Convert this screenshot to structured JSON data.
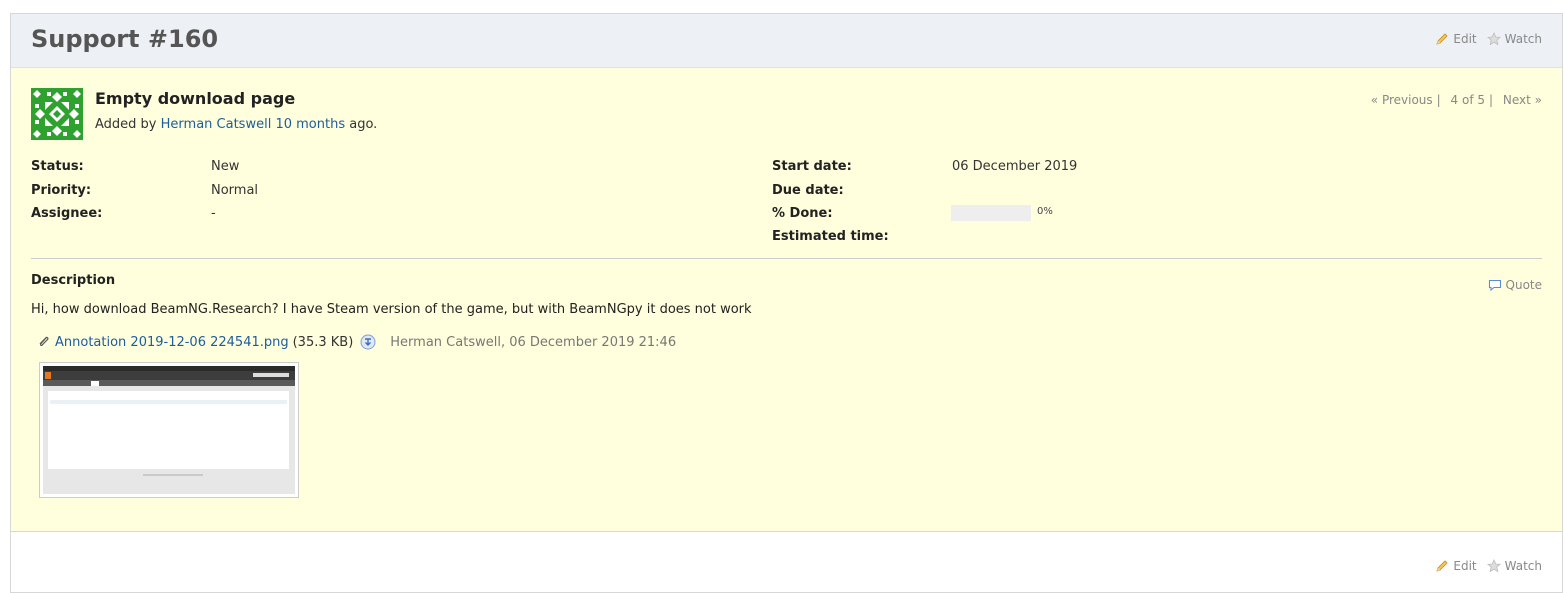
{
  "header": {
    "title": "Support #160",
    "edit_label": "Edit",
    "watch_label": "Watch"
  },
  "issue": {
    "subject": "Empty download page",
    "added_by_prefix": "Added by",
    "author": "Herman Catswell",
    "age": "10 months",
    "age_suffix": "ago.",
    "nav": {
      "previous": "« Previous",
      "position": "4 of 5",
      "next": "Next »"
    },
    "attributes": {
      "status": {
        "label": "Status:",
        "value": "New"
      },
      "priority": {
        "label": "Priority:",
        "value": "Normal"
      },
      "assignee": {
        "label": "Assignee:",
        "value": "-"
      },
      "start_date": {
        "label": "Start date:",
        "value": "06 December 2019"
      },
      "due_date": {
        "label": "Due date:",
        "value": ""
      },
      "done": {
        "label": "% Done:",
        "value": "0%",
        "fraction": 0
      },
      "estimated": {
        "label": "Estimated time:",
        "value": ""
      }
    },
    "description": {
      "title": "Description",
      "quote_label": "Quote",
      "text": "Hi, how download BeamNG.Research? I have Steam version of the game, but with BeamNGpy it does not work"
    },
    "attachment": {
      "filename": "Annotation 2019-12-06 224541.png",
      "size": "(35.3 KB)",
      "meta": "Herman Catswell, 06 December 2019 21:46"
    }
  },
  "footer": {
    "edit_label": "Edit",
    "watch_label": "Watch"
  },
  "colors": {
    "header_bg": "#edf1f6",
    "issue_bg": "#ffffdd",
    "link": "#1d5d9b",
    "avatar_green": "#2ea12e"
  },
  "icons": [
    "pencil-icon",
    "star-icon",
    "comment-icon",
    "paperclip-icon",
    "download-icon"
  ]
}
